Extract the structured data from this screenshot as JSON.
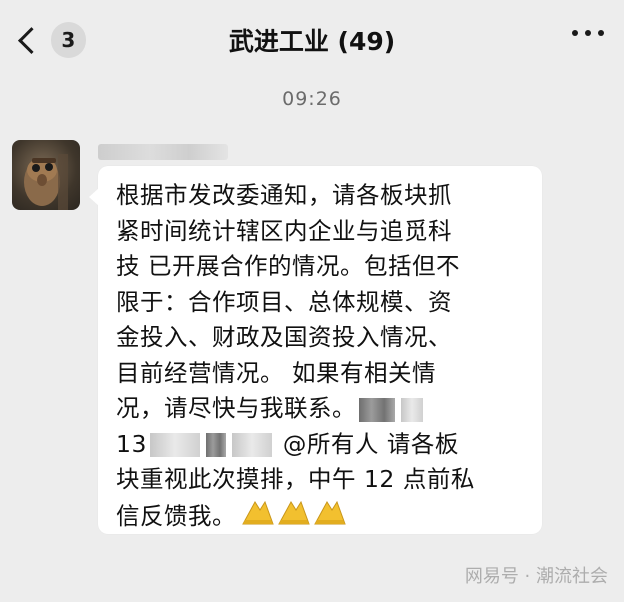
{
  "header": {
    "back_badge": "3",
    "title": "武进工业 (49)",
    "icons": {
      "back": "chevron-left-icon",
      "more": "more-dots-icon"
    }
  },
  "chat": {
    "timestamp": "09:26",
    "message": {
      "lines": [
        "根据市发改委通知，请各板块抓",
        "紧时间统计辖区内企业与追觅科",
        "技 已开展合作的情况。包括但不",
        "限于：合作项目、总体规模、资",
        "金投入、财政及国资投入情况、",
        "目前经营情况。 如果有相关情",
        "况，请尽快与我联系。",
        "13",
        "@所有人  请各板",
        "块重视此次摸排，中午 12 点前私",
        "信反馈我。"
      ],
      "emoji": [
        "folded-hands",
        "folded-hands",
        "folded-hands"
      ]
    }
  },
  "watermark": "网易号 · 潮流社会"
}
